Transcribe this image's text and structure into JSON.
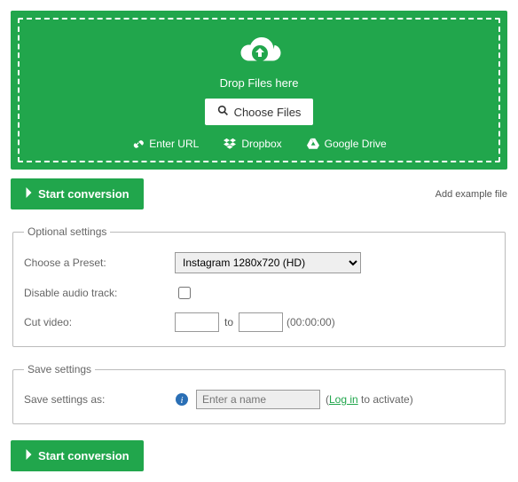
{
  "dropzone": {
    "drop_text": "Drop Files here",
    "choose_label": "Choose Files",
    "sources": {
      "url": "Enter URL",
      "dropbox": "Dropbox",
      "gdrive": "Google Drive"
    }
  },
  "buttons": {
    "start": "Start conversion",
    "example": "Add example file"
  },
  "optional": {
    "legend": "Optional settings",
    "preset_label": "Choose a Preset:",
    "preset_value": "Instagram 1280x720 (HD)",
    "disable_audio_label": "Disable audio track:",
    "cut_video_label": "Cut video:",
    "to_label": "to",
    "cut_hint": "(00:00:00)"
  },
  "save": {
    "legend": "Save settings",
    "label": "Save settings as:",
    "placeholder": "Enter a name",
    "paren_open": "(",
    "login": "Log in",
    "activate": " to activate)"
  }
}
